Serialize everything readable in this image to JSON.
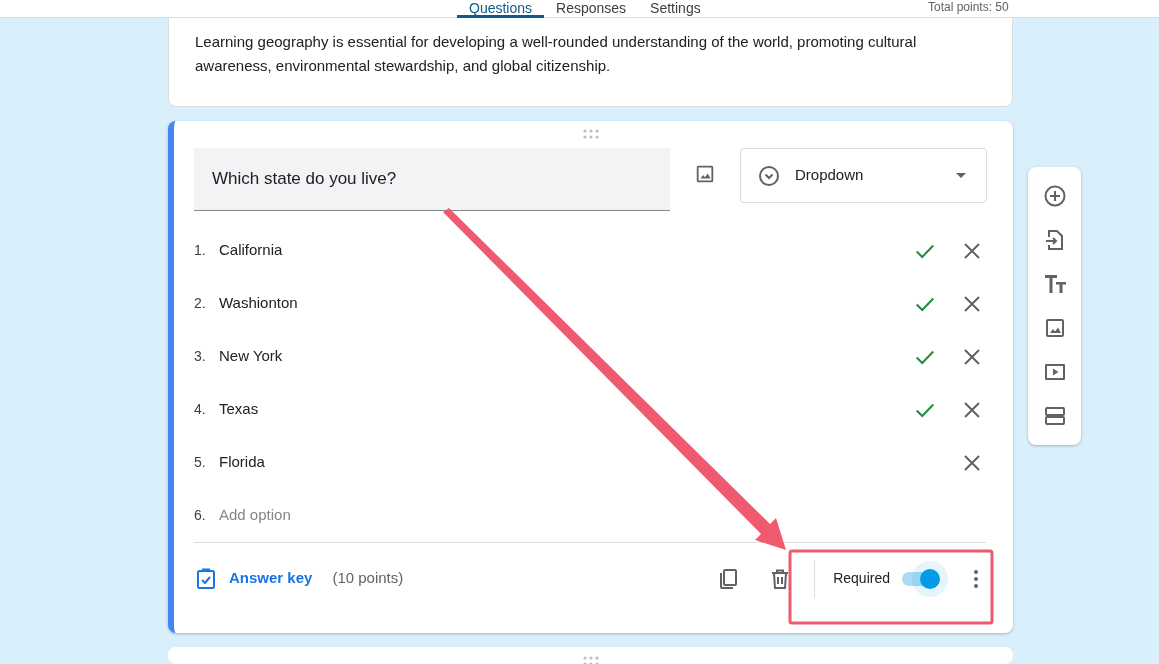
{
  "tabs": [
    {
      "label": "Questions",
      "selected": true
    },
    {
      "label": "Responses",
      "selected": false
    },
    {
      "label": "Settings",
      "selected": false
    }
  ],
  "total_points": "Total points: 50",
  "description": "Learning geography is essential for developing a well-rounded understanding of the world, promoting cultural awareness, environmental stewardship, and global citizenship.",
  "question": {
    "title": "Which state do you live?",
    "type": "Dropdown",
    "options": [
      {
        "number": "1.",
        "label": "California",
        "correct": true
      },
      {
        "number": "2.",
        "label": "Washionton",
        "correct": true
      },
      {
        "number": "3.",
        "label": "New York",
        "correct": true
      },
      {
        "number": "4.",
        "label": "Texas",
        "correct": true
      },
      {
        "number": "5.",
        "label": "Florida",
        "correct": false
      }
    ],
    "add_option": {
      "number": "6.",
      "placeholder": "Add option"
    },
    "answer_key": "Answer key",
    "points": "(10 points)",
    "required_label": "Required",
    "required": true
  }
}
